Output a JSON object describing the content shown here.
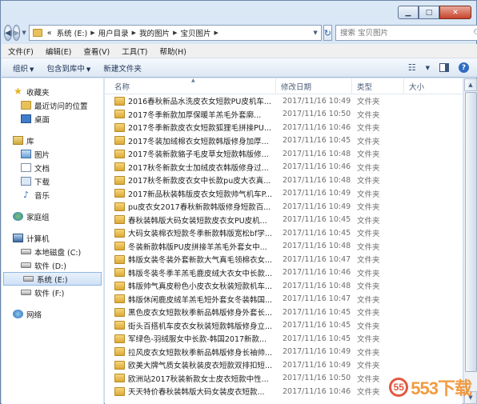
{
  "window": {
    "caption_buttons": {
      "minimize": "▁",
      "maximize": "□",
      "close": "✕"
    }
  },
  "address": {
    "prefix": "«",
    "crumbs": [
      "系统 (E:)",
      "用户目录",
      "我的图片",
      "宝贝图片"
    ],
    "search_placeholder": "搜索 宝贝图片"
  },
  "menu": [
    "文件(F)",
    "编辑(E)",
    "查看(V)",
    "工具(T)",
    "帮助(H)"
  ],
  "toolbar": {
    "organize": "组织",
    "include_library": "包含到库中",
    "new_folder": "新建文件夹"
  },
  "nav": {
    "favorites": "收藏夹",
    "recent": "最近访问的位置",
    "desktop": "桌面",
    "library": "库",
    "pictures": "图片",
    "documents": "文档",
    "downloads": "下载",
    "music": "音乐",
    "homegroup": "家庭组",
    "computer": "计算机",
    "drive_c": "本地磁盘 (C:)",
    "drive_d": "软件 (D:)",
    "drive_e": "系统 (E:)",
    "drive_f": "软件 (F:)",
    "network": "网络"
  },
  "columns": {
    "name": "名称",
    "date": "修改日期",
    "type": "类型",
    "size": "大小"
  },
  "files": [
    {
      "name": "2016春秋新品水洗皮衣女短款PU皮机车...",
      "date": "2017/11/16 10:49",
      "type": "文件夹"
    },
    {
      "name": "2017冬季新款加厚保暖羊羔毛外套廓...",
      "date": "2017/11/16 10:50",
      "type": "文件夹"
    },
    {
      "name": "2017冬季新款皮衣女短款狐狸毛拼接PU...",
      "date": "2017/11/16 10:46",
      "type": "文件夹"
    },
    {
      "name": "2017冬装加绒棉衣女短款韩版修身加厚...",
      "date": "2017/11/16 10:45",
      "type": "文件夹"
    },
    {
      "name": "2017冬装新款貉子毛皮草女短款韩版修...",
      "date": "2017/11/16 10:48",
      "type": "文件夹"
    },
    {
      "name": "2017秋冬新款女士加绒皮衣韩版修身过...",
      "date": "2017/11/16 10:46",
      "type": "文件夹"
    },
    {
      "name": "2017秋冬新款皮衣女中长款pu皮大衣真...",
      "date": "2017/11/16 10:48",
      "type": "文件夹"
    },
    {
      "name": "2017新品秋装韩版皮衣女短款帅气机车P...",
      "date": "2017/11/16 10:49",
      "type": "文件夹"
    },
    {
      "name": "pu皮衣女2017春秋新款韩版修身短款百...",
      "date": "2017/11/16 10:49",
      "type": "文件夹"
    },
    {
      "name": "春秋装韩版大码女装短款皮衣女PU皮机...",
      "date": "2017/11/16 10:45",
      "type": "文件夹"
    },
    {
      "name": "大码女装棉衣短款冬季新款韩版宽松bf学...",
      "date": "2017/11/16 10:45",
      "type": "文件夹"
    },
    {
      "name": "冬装新款韩版PU皮拼接羊羔毛外套女中...",
      "date": "2017/11/16 10:48",
      "type": "文件夹"
    },
    {
      "name": "韩版女装冬装外套新款大气真毛领棉衣女...",
      "date": "2017/11/16 10:47",
      "type": "文件夹"
    },
    {
      "name": "韩版冬装冬季羊羔毛鹿皮绒大衣女中长款...",
      "date": "2017/11/16 10:46",
      "type": "文件夹"
    },
    {
      "name": "韩版帅气真皮粉色小皮衣女秋装短款机车...",
      "date": "2017/11/16 10:48",
      "type": "文件夹"
    },
    {
      "name": "韩版休闲鹿皮绒羊羔毛短外套女冬装韩国...",
      "date": "2017/11/16 10:47",
      "type": "文件夹"
    },
    {
      "name": "黑色皮衣女短款秋季新品韩版修身外套长...",
      "date": "2017/11/16 10:45",
      "type": "文件夹"
    },
    {
      "name": "街头百搭机车皮衣女秋装短款韩版修身立...",
      "date": "2017/11/16 10:45",
      "type": "文件夹"
    },
    {
      "name": "军绿色-羽绒服女中长款-韩国2017新款...",
      "date": "2017/11/16 10:45",
      "type": "文件夹"
    },
    {
      "name": "拉风皮衣女短款秋季新品韩版修身长袖帅...",
      "date": "2017/11/16 10:49",
      "type": "文件夹"
    },
    {
      "name": "欧美大牌气质女装秋装皮衣短款双排扣短...",
      "date": "2017/11/16 10:49",
      "type": "文件夹"
    },
    {
      "name": "欧洲站2017秋装新款女士皮衣短款中性...",
      "date": "2017/11/16 10:50",
      "type": "文件夹"
    },
    {
      "name": "天天特价春秋装韩版大码女装皮衣短款...",
      "date": "2017/11/16 10:46",
      "type": "文件夹"
    }
  ],
  "watermark": {
    "logo": "55",
    "text": "553下载"
  }
}
